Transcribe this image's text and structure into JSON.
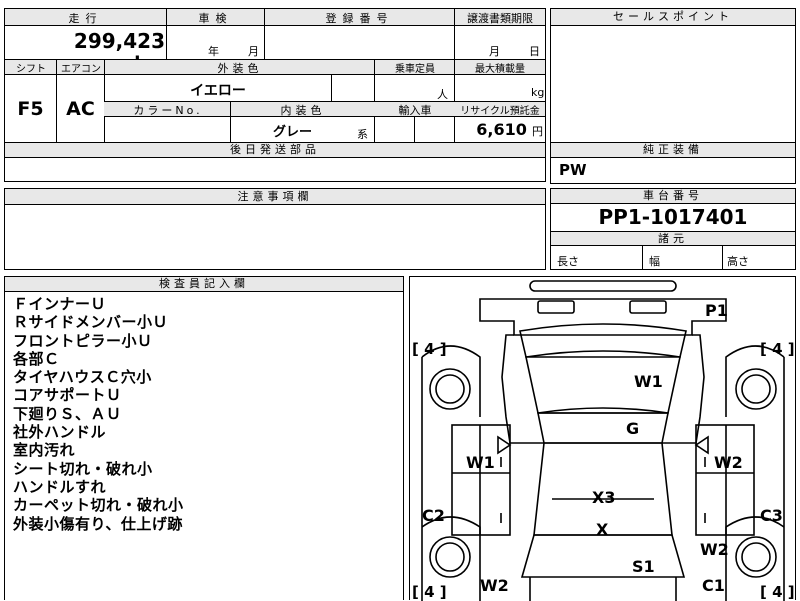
{
  "top_row": {
    "col1": "走行",
    "col2": "車検",
    "col3": "登録番号",
    "col4": "譲渡書類期限",
    "sale_points": "セールスポイント",
    "mileage": "299,423",
    "mileage_unit": "km",
    "inspect_year": "年",
    "inspect_month": "月",
    "deadline_month": "月",
    "deadline_day": "日"
  },
  "row2": {
    "shift_label": "シフト",
    "aircon_label": "エアコン",
    "ext_color_label": "外装色",
    "capacity_label": "乗車定員",
    "max_load_label": "最大積載量",
    "shift_value": "F5",
    "aircon_value": "AC",
    "ext_color_value": "イエロー",
    "capacity_unit": "人",
    "load_unit": "kg",
    "color_no_label": "カラーNo.",
    "int_color_label": "内装色",
    "import_label": "輸入車",
    "recycle_label": "リサイクル預託金",
    "int_color_value": "グレー",
    "int_color_suffix": "系",
    "recycle_value": "6,610",
    "recycle_unit": "円"
  },
  "shipping_parts_label": "後日発送部品",
  "genuine_equipment_label": "純正装備",
  "genuine_equipment_value": "PW",
  "caution_label": "注意事項欄",
  "chassis": {
    "label": "車台番号",
    "value": "PP1-1017401",
    "specs_label": "諸元",
    "length": "長さ",
    "width": "幅",
    "height": "高さ"
  },
  "inspector": {
    "label": "検査員記入欄",
    "notes": [
      "ＦインナーＵ",
      "Ｒサイドメンバー小Ｕ",
      "フロントピラー小Ｕ",
      "各部Ｃ",
      "タイヤハウスＣ穴小",
      "コアサポートＵ",
      "下廻りＳ、ＡＵ",
      "社外ハンドル",
      "室内汚れ",
      "シート切れ・破れ小",
      "ハンドルすれ",
      "カーペット切れ・破れ小",
      "外装小傷有り、仕上げ跡"
    ]
  },
  "diagram": {
    "marks": [
      "P1",
      "W1",
      "G",
      "W1",
      "W2",
      "X3",
      "C2",
      "C3",
      "X",
      "W2",
      "S1",
      "W2",
      "C1"
    ],
    "tires": [
      "4",
      "4",
      "4",
      "4"
    ],
    "bracket_left": "[",
    "bracket_right": "]"
  }
}
